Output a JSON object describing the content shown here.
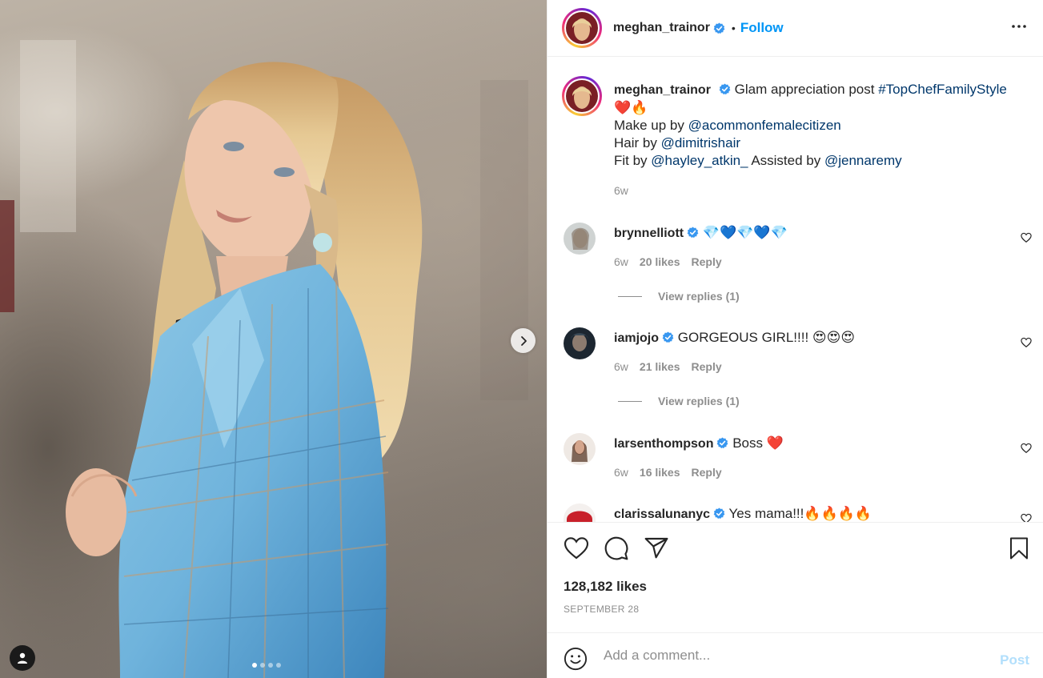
{
  "photo": {
    "carousel_dots": 4,
    "active_dot": 1,
    "next_icon": "chevron-right-icon",
    "user_tag_icon": "user-icon"
  },
  "header": {
    "username": "meghan_trainor",
    "verified": true,
    "separator": "•",
    "follow_label": "Follow",
    "more_icon": "more-horizontal-icon"
  },
  "caption": {
    "username": "meghan_trainor",
    "text_prefix": "Glam appreciation post",
    "hashtag": "#TopChefFamilyStyle",
    "emojis": "❤️🔥",
    "makeup_label": "Make up by",
    "makeup_mention": "@acommonfemalecitizen",
    "hair_label": "Hair by",
    "hair_mention": "@dimitrishair",
    "fit_label": "Fit by",
    "fit_mention": "@hayley_atkin_",
    "assisted_label": "Assisted by",
    "assisted_mention": "@jennaremy",
    "time": "6w"
  },
  "comments": [
    {
      "username": "brynnelliott",
      "verified": true,
      "text": "💎💙💎💙💎",
      "time": "6w",
      "likes": "20 likes",
      "reply": "Reply",
      "view_replies": "View replies (1)"
    },
    {
      "username": "iamjojo",
      "verified": true,
      "text": "GORGEOUS GIRL!!!! 😍😍😍",
      "time": "6w",
      "likes": "21 likes",
      "reply": "Reply",
      "view_replies": "View replies (1)"
    },
    {
      "username": "larsenthompson",
      "verified": true,
      "text": "Boss ❤️",
      "time": "6w",
      "likes": "16 likes",
      "reply": "Reply"
    },
    {
      "username": "clarissalunanyc",
      "verified": true,
      "text": "Yes mama!!!🔥🔥🔥🔥"
    }
  ],
  "actions": {
    "like_icon": "heart-icon",
    "comment_icon": "comment-icon",
    "share_icon": "send-icon",
    "save_icon": "bookmark-icon",
    "likes": "128,182 likes",
    "date": "SEPTEMBER 28"
  },
  "add_comment": {
    "emoji_icon": "smiley-icon",
    "placeholder": "Add a comment...",
    "post_label": "Post"
  },
  "colors": {
    "accent": "#0095f6",
    "post_disabled": "#b2dffc",
    "link": "#00376b",
    "muted": "#8e8e8e",
    "text": "#262626"
  }
}
